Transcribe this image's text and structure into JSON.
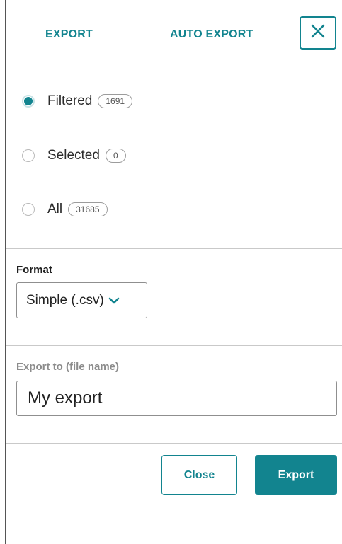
{
  "header": {
    "tabs": [
      {
        "label": "EXPORT"
      },
      {
        "label": "AUTO EXPORT"
      }
    ],
    "close_icon": "close-x-icon"
  },
  "scope": {
    "options": [
      {
        "label": "Filtered",
        "count": "1691",
        "checked": true
      },
      {
        "label": "Selected",
        "count": "0",
        "checked": false
      },
      {
        "label": "All",
        "count": "31685",
        "checked": false
      }
    ]
  },
  "format": {
    "label": "Format",
    "selected": "Simple (.csv)",
    "chevron_icon": "chevron-down-icon"
  },
  "export_to": {
    "label": "Export to (file name)",
    "value": "My export"
  },
  "actions": {
    "close_label": "Close",
    "export_label": "Export"
  },
  "colors": {
    "accent": "#12848f"
  }
}
